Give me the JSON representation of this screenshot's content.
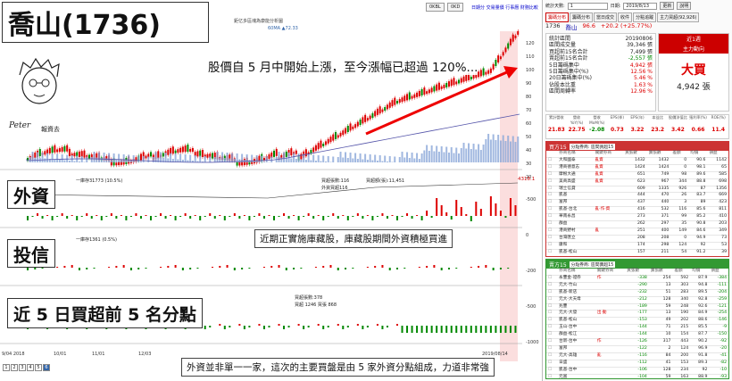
{
  "headline": {
    "title": "喬山(1736)",
    "subtitle": "股價自 5 月中開始上漲，至今漲幅已超過 120%...",
    "label_foreign": "外資",
    "label_trust": "投信",
    "label_top5": "近 5 日買超前 5 名分點",
    "note_buyback": "近期正實施庫藏股，庫藏股期間外資積極買進",
    "note_bottom": "外資並非單一一家，這次的主要買盤是由 5 家外資分點組成，力道非常強"
  },
  "logo": {
    "name": "Peter",
    "cn": "報資去"
  },
  "chart": {
    "top_title": "鉅亿多區塊為康能分析圖",
    "ma_label": "60MA ▲72.33",
    "top_left": "60.00",
    "foreign_legend": "一庫存31773 (10.5%)",
    "foreign_legend2": "買超張數:116",
    "foreign_legend3": "外資買超116",
    "foreign_legend4": "買超額(張):11,451",
    "foreign_value": "4318.1",
    "trust_legend": "一庫存1361 (0.5%)",
    "top5_legend": "買超張數:378",
    "top5_legend2": "買超 1246 買張 868",
    "date_ticks": [
      "9/04 2018",
      "10/01",
      "11/01",
      "12/03",
      "2019/08/14"
    ],
    "y_ticks": [
      "120",
      "110",
      "100",
      "90",
      "80",
      "70",
      "60",
      "50",
      "40",
      "30",
      "20"
    ],
    "sub_ticks": [
      "-500",
      "0",
      "-200",
      "-500",
      "-1000"
    ],
    "pages": [
      "1",
      "2",
      "3",
      "4",
      "5",
      "6"
    ]
  },
  "toolbar": {
    "left_btn1": "0KBL",
    "left_btn2": "0KD",
    "link1": "日期分",
    "link2": "交易量價",
    "link3": "行事曆",
    "link4": "財務比較",
    "period": "統計天數:",
    "period_val": "1",
    "date_label": "日期:",
    "date_val": "2019/8/13",
    "refresh": "更新",
    "help": "說明"
  },
  "quote": {
    "tabs": [
      "籌碼分布",
      "籌碼分布",
      "當日成交",
      "收件",
      "分點追蹤",
      "主力買超(92,926)"
    ],
    "code": "1736",
    "name": "喬山",
    "price": "96.6",
    "change": "+20.2 (+25.77%)"
  },
  "stats": [
    {
      "k": "統計區間",
      "v": "20190806"
    },
    {
      "k": "區間成交量",
      "v": "39,346 張"
    },
    {
      "k": "買超前15名合計",
      "v": "7,499 張"
    },
    {
      "k": "賣超前15名合計",
      "v": "-2,557 張"
    },
    {
      "k": "5日籌碼集中",
      "v": "4,942 張"
    },
    {
      "k": "5日籌碼集中(%)",
      "v": "12.56 %"
    },
    {
      "k": "20日籌碼集中(%)",
      "v": "5.46 %"
    },
    {
      "k": "佔股本比重",
      "v": "1.63 %"
    },
    {
      "k": "區間周轉率",
      "v": "12.96 %"
    }
  ],
  "main": {
    "head": "近1週",
    "sub": "主力動向",
    "action": "大買",
    "amount": "4,942 張"
  },
  "metrics": {
    "labels": [
      "累計營收",
      "營收YoY(%)",
      "營收MoM(%)",
      "EPS(季)",
      "EPS(年)",
      "本益比",
      "股價淨值比",
      "殖利率(%)",
      "ROE(%)"
    ],
    "values": [
      "21.83",
      "22.75",
      "-2.08",
      "0.73",
      "3.22",
      "23.2",
      "3.42",
      "0.66",
      "11.4"
    ]
  },
  "buy_section": {
    "title": "買方15",
    "filter": "分點券商: 區間買超15",
    "cols": [
      "券商名稱",
      "關鍵券商",
      "買張數",
      "賣張數",
      "差額",
      "均價",
      "損益"
    ],
    "rows": [
      [
        "大和國泰",
        "亂資",
        "1432",
        "1432",
        "0",
        "90.6",
        "1142"
      ],
      [
        "港商德意志",
        "亂資",
        "1424",
        "1424",
        "0",
        "98.1",
        "65"
      ],
      [
        "摩根大通",
        "亂資",
        "651",
        "749",
        "98",
        "89.6",
        "585"
      ],
      [
        "美商高盛",
        "亂資",
        "623",
        "967",
        "344",
        "88.8",
        "698"
      ],
      [
        "瑞士信貸",
        "",
        "609",
        "1335",
        "926",
        "87",
        "1356"
      ],
      [
        "凱基",
        "",
        "444",
        "470",
        "26",
        "83.7",
        "669"
      ],
      [
        "富邦",
        "",
        "437",
        "440",
        "3",
        "89",
        "423"
      ],
      [
        "凱基-台北",
        "亂·作·資",
        "416",
        "532",
        "116",
        "85.6",
        "811"
      ],
      [
        "華南永昌",
        "",
        "273",
        "371",
        "99",
        "85.2",
        "410"
      ],
      [
        "群益",
        "",
        "262",
        "297",
        "35",
        "90.8",
        "203"
      ],
      [
        "港商野村",
        "亂",
        "251",
        "400",
        "149",
        "84.6",
        "349"
      ],
      [
        "台灣匯立",
        "",
        "208",
        "208",
        "0",
        "94.9",
        "73"
      ],
      [
        "康和",
        "",
        "174",
        "298",
        "124",
        "92",
        "53"
      ],
      [
        "凱基-松山",
        "",
        "157",
        "211",
        "54",
        "91.2",
        "39"
      ],
      [
        "元大",
        "",
        "148",
        "198",
        "50",
        "88.5",
        "205"
      ]
    ]
  },
  "sell_section": {
    "title": "賣方15",
    "filter": "分點券商: 區間賣超15",
    "cols": [
      "券商名稱",
      "關鍵券商",
      "買張數",
      "賣張數",
      "差額",
      "均價",
      "損益"
    ],
    "rows": [
      [
        "永豐金-證券",
        "作",
        "-338",
        "254",
        "592",
        "87.9",
        "-384"
      ],
      [
        "元大-竹山",
        "",
        "-290",
        "13",
        "303",
        "94.8",
        "-111"
      ],
      [
        "凱基-新店",
        "",
        "-232",
        "51",
        "283",
        "89.5",
        "-204"
      ],
      [
        "元大-大天母",
        "",
        "-212",
        "128",
        "340",
        "92.8",
        "-259"
      ],
      [
        "兆豐",
        "",
        "-189",
        "59",
        "248",
        "92.6",
        "-121"
      ],
      [
        "元大-大發",
        "出·動",
        "-177",
        "13",
        "190",
        "84.9",
        "-254"
      ],
      [
        "凱基-松山",
        "",
        "-153",
        "49",
        "202",
        "88.6",
        "-146"
      ],
      [
        "玉山-台中",
        "",
        "-144",
        "71",
        "215",
        "85.5",
        "-9"
      ],
      [
        "群益-松江",
        "",
        "-144",
        "10",
        "154",
        "87.7",
        "-150"
      ],
      [
        "台新-台中",
        "作",
        "-126",
        "317",
        "443",
        "90.2",
        "-92"
      ],
      [
        "富邦",
        "",
        "-122",
        "2",
        "124",
        "96.9",
        "-20"
      ],
      [
        "元大-高雄",
        "亂",
        "-116",
        "84",
        "200",
        "91.8",
        "-41"
      ],
      [
        "日盛",
        "",
        "-112",
        "41",
        "153",
        "89.3",
        "-82"
      ],
      [
        "凱基-台中",
        "",
        "-106",
        "128",
        "234",
        "92",
        "-10"
      ],
      [
        "元富",
        "",
        "-104",
        "59",
        "163",
        "88.9",
        "-93"
      ]
    ]
  }
}
